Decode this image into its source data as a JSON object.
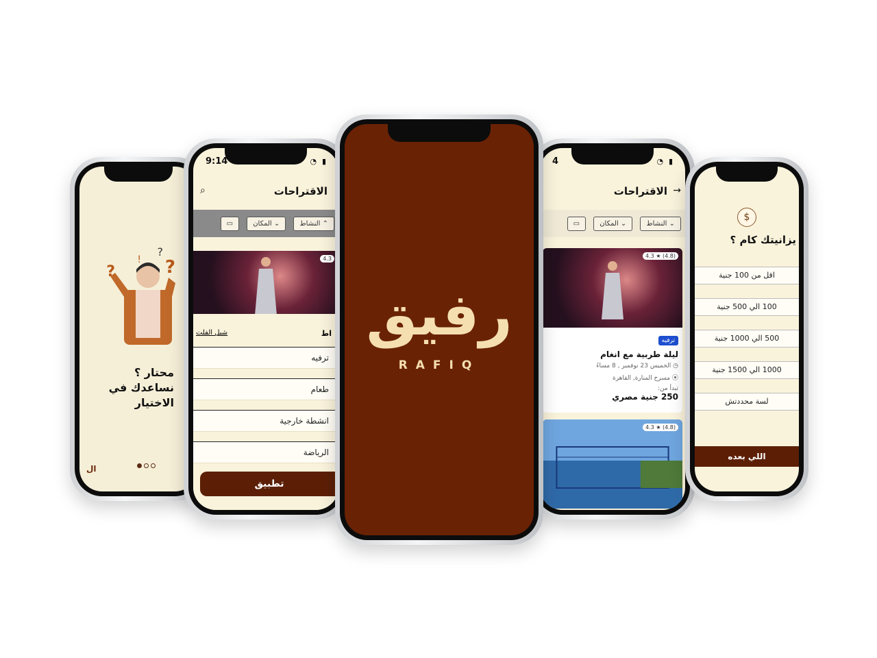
{
  "screen1": {
    "title_line1": "محتار ؟",
    "title_line2": "نساعدك في الاختيار",
    "skip_label": "ال"
  },
  "screen2": {
    "status_time": "9:14",
    "header_title": "الاقتراحات",
    "chips": [
      "النشاط",
      "المكان"
    ],
    "rating": "4.3",
    "sheet_title": "اط",
    "clear_label": "شيل الفلت",
    "options": [
      "ترفيه",
      "طعام",
      "انشطة خارجية",
      "الرياضة"
    ],
    "apply_label": "تطبيق"
  },
  "screen3": {
    "logo_arabic": "رفيق",
    "logo_latin": "RAFIQ"
  },
  "screen4": {
    "status_time": "4",
    "header_title": "الاقتراحات",
    "chips": [
      "النشاط",
      "المكان"
    ],
    "card1": {
      "rating": "4.3 ★ (4.8)",
      "badge": "ترفيه",
      "title": "ليلة طربية مع انغام",
      "date": "الخميس 23 نوفمبر , 8 مساءً",
      "location": "مسرح المنارة, القاهرة",
      "price_prefix": "تبدأ من:",
      "price": "250 جنية مصري"
    },
    "card2": {
      "rating": "4.3 ★ (4.8)"
    }
  },
  "screen5": {
    "question": "يزانيتك كام ؟",
    "options": [
      "اقل من 100 جنية",
      "100 الي 500 جنية",
      "500 الي 1000 جنية",
      "1000 الي 1500 جنية",
      "لسة محددتش"
    ],
    "next_label": "اللي بعده",
    "step_icon": "$"
  },
  "colors": {
    "brand": "#6a2204",
    "cream": "#faf3dc",
    "badge": "#1d4fd0"
  }
}
